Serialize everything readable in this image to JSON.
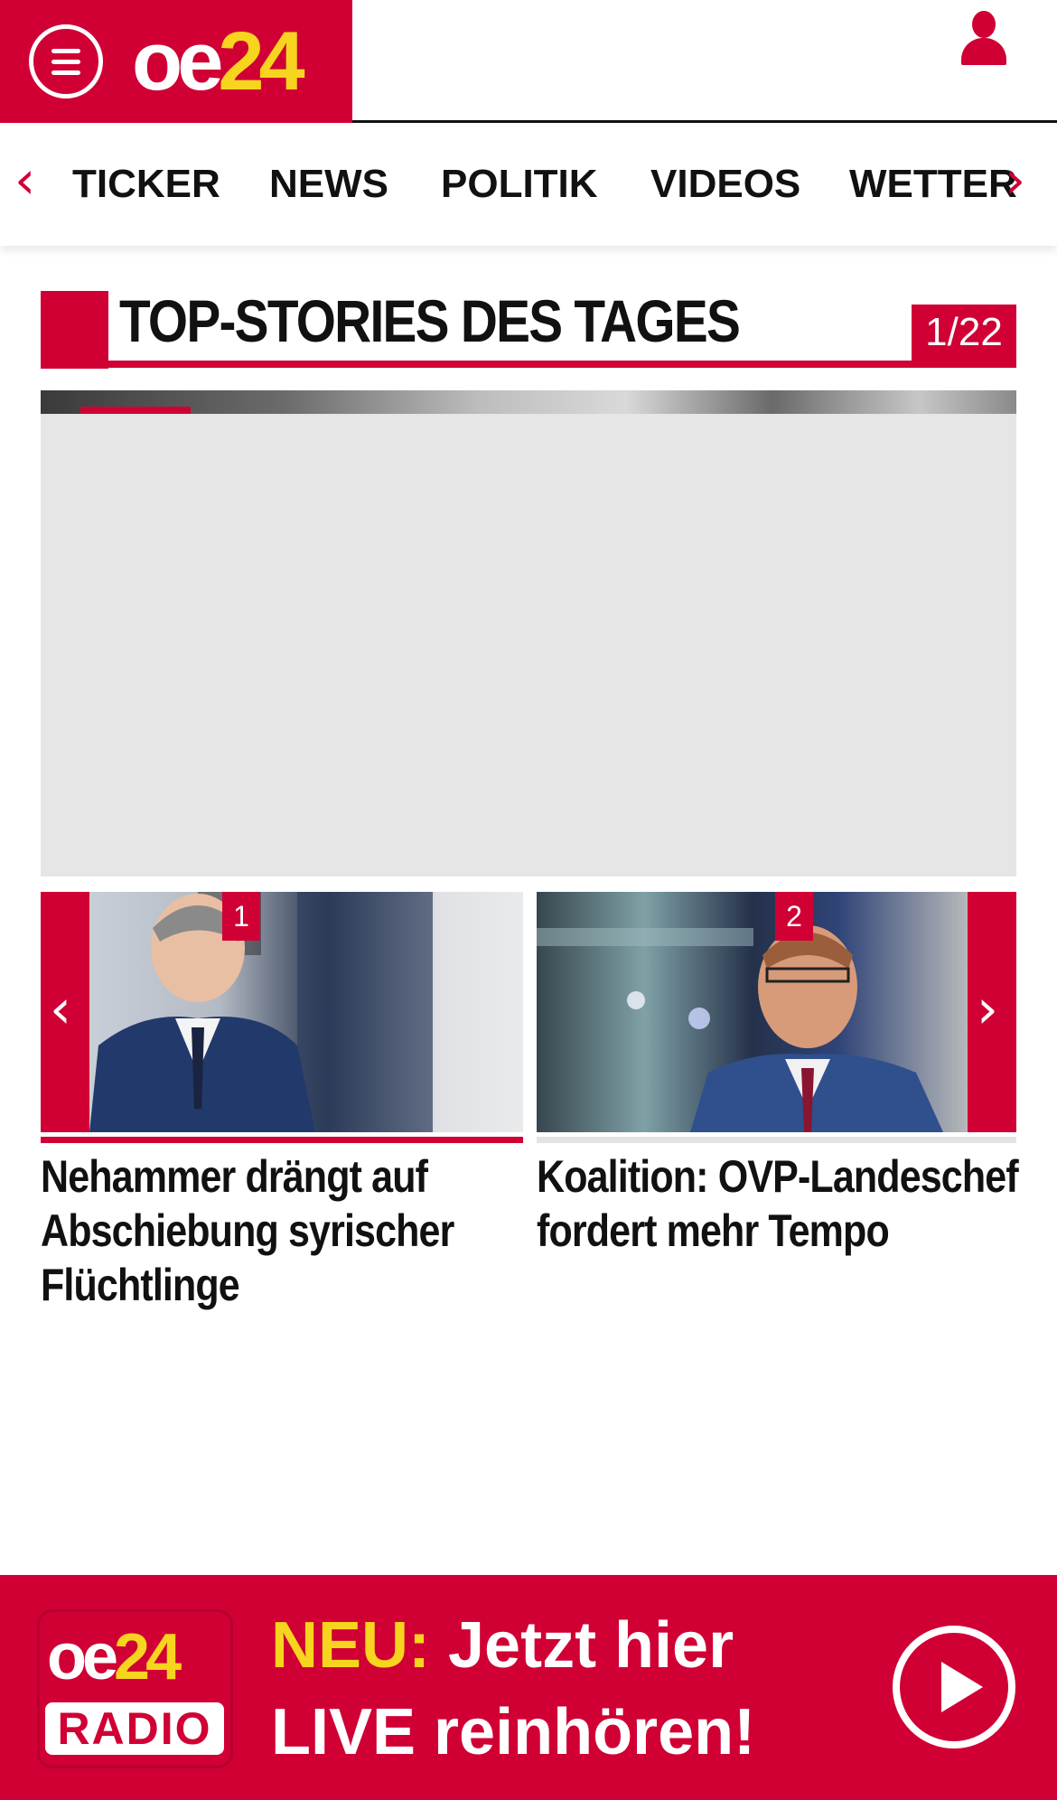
{
  "header": {
    "brand_oe": "oe",
    "brand_num": "24",
    "menu_icon": "hamburger-menu-icon",
    "user_icon": "user-icon"
  },
  "nav": {
    "prev_icon": "chevron-left-icon",
    "next_icon": "chevron-right-icon",
    "items": [
      "TICKER",
      "NEWS",
      "POLITIK",
      "VIDEOS",
      "WETTER"
    ]
  },
  "section": {
    "title": "TOP-STORIES DES TAGES",
    "counter": "1/22"
  },
  "carousel": {
    "prev_icon": "chevron-left-icon",
    "next_icon": "chevron-right-icon",
    "stories": [
      {
        "rank": "1",
        "title": "Nehammer drängt auf Abschiebung syrischer Flüchtlinge",
        "active": true
      },
      {
        "rank": "2",
        "title": "Koalition: OVP-Landeschef fordert mehr Tempo",
        "active": false
      }
    ]
  },
  "radio_banner": {
    "logo_oe": "oe",
    "logo_num": "24",
    "logo_label": "RADIO",
    "highlight": "NEU:",
    "line1": " Jetzt hier",
    "line2": "LIVE reinhören!",
    "play_icon": "play-icon"
  },
  "colors": {
    "brand_red": "#d00034",
    "brand_yellow": "#f7d51e",
    "placeholder_gray": "#e6e6e6"
  }
}
